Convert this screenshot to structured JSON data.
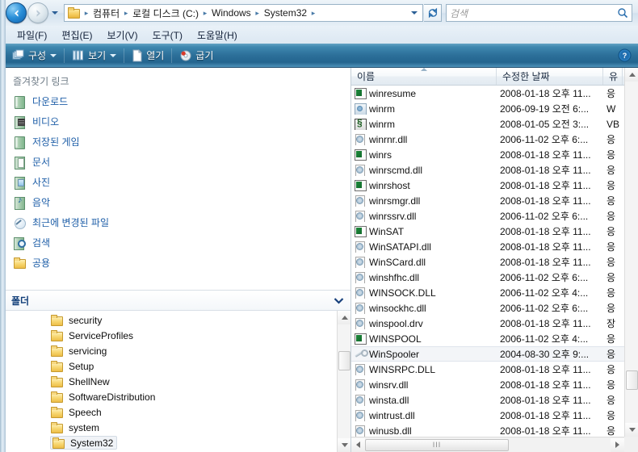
{
  "window": {
    "nav": {
      "back_label": "뒤로",
      "forward_label": "앞으로",
      "history_label": "최근 위치",
      "refresh_label": "새로 고침"
    },
    "breadcrumb": {
      "items": [
        "컴퓨터",
        "로컬 디스크 (C:)",
        "Windows",
        "System32"
      ],
      "separator": "▸"
    },
    "search": {
      "placeholder": "검색"
    }
  },
  "menubar": {
    "items": [
      "파일(F)",
      "편집(E)",
      "보기(V)",
      "도구(T)",
      "도움말(H)"
    ]
  },
  "toolbar": {
    "organize": "구성",
    "views": "보기",
    "open": "열기",
    "burn": "굽기",
    "help_label": "도움말"
  },
  "sidebar": {
    "favorites_title": "즐겨찾기 링크",
    "items": [
      {
        "label": "다운로드",
        "icon": "shellfolder-icon"
      },
      {
        "label": "비디오",
        "icon": "video-folder-icon"
      },
      {
        "label": "저장된 게임",
        "icon": "shellfolder-icon"
      },
      {
        "label": "문서",
        "icon": "documents-folder-icon"
      },
      {
        "label": "사진",
        "icon": "pictures-folder-icon"
      },
      {
        "label": "음악",
        "icon": "music-folder-icon"
      },
      {
        "label": "최근에 변경된 파일",
        "icon": "recent-changes-icon"
      },
      {
        "label": "검색",
        "icon": "saved-search-icon"
      },
      {
        "label": "공용",
        "icon": "public-folder-icon"
      }
    ],
    "folders_title": "폴더",
    "tree": [
      {
        "label": "security",
        "selected": false
      },
      {
        "label": "ServiceProfiles",
        "selected": false
      },
      {
        "label": "servicing",
        "selected": false
      },
      {
        "label": "Setup",
        "selected": false
      },
      {
        "label": "ShellNew",
        "selected": false
      },
      {
        "label": "SoftwareDistribution",
        "selected": false
      },
      {
        "label": "Speech",
        "selected": false
      },
      {
        "label": "system",
        "selected": false
      },
      {
        "label": "System32",
        "selected": true
      }
    ]
  },
  "filelist": {
    "columns": [
      {
        "label": "이름",
        "sorted": "asc"
      },
      {
        "label": "수정한 날짜",
        "sorted": ""
      },
      {
        "label": "유",
        "sorted": ""
      }
    ],
    "rows": [
      {
        "name": "winresume",
        "date": "2008-01-18 오후 11...",
        "type": "응",
        "icon": "exe",
        "selected": false
      },
      {
        "name": "winrm",
        "date": "2006-09-19 오전 6:...",
        "type": "W",
        "icon": "cmd",
        "selected": false
      },
      {
        "name": "winrm",
        "date": "2008-01-05 오전 3:...",
        "type": "VB",
        "icon": "vbs",
        "selected": false
      },
      {
        "name": "winrnr.dll",
        "date": "2006-11-02 오후 6:...",
        "type": "응",
        "icon": "dll",
        "selected": false
      },
      {
        "name": "winrs",
        "date": "2008-01-18 오후 11...",
        "type": "응",
        "icon": "exe",
        "selected": false
      },
      {
        "name": "winrscmd.dll",
        "date": "2008-01-18 오후 11...",
        "type": "응",
        "icon": "dll",
        "selected": false
      },
      {
        "name": "winrshost",
        "date": "2008-01-18 오후 11...",
        "type": "응",
        "icon": "exe",
        "selected": false
      },
      {
        "name": "winrsmgr.dll",
        "date": "2008-01-18 오후 11...",
        "type": "응",
        "icon": "dll",
        "selected": false
      },
      {
        "name": "winrssrv.dll",
        "date": "2006-11-02 오후 6:...",
        "type": "응",
        "icon": "dll",
        "selected": false
      },
      {
        "name": "WinSAT",
        "date": "2008-01-18 오후 11...",
        "type": "응",
        "icon": "exe",
        "selected": false
      },
      {
        "name": "WinSATAPI.dll",
        "date": "2008-01-18 오후 11...",
        "type": "응",
        "icon": "dll",
        "selected": false
      },
      {
        "name": "WinSCard.dll",
        "date": "2008-01-18 오후 11...",
        "type": "응",
        "icon": "dll",
        "selected": false
      },
      {
        "name": "winshfhc.dll",
        "date": "2006-11-02 오후 6:...",
        "type": "응",
        "icon": "dll",
        "selected": false
      },
      {
        "name": "WINSOCK.DLL",
        "date": "2006-11-02 오후 4:...",
        "type": "응",
        "icon": "dll",
        "selected": false
      },
      {
        "name": "winsockhc.dll",
        "date": "2006-11-02 오후 6:...",
        "type": "응",
        "icon": "dll",
        "selected": false
      },
      {
        "name": "winspool.drv",
        "date": "2008-01-18 오후 11...",
        "type": "장",
        "icon": "drv",
        "selected": false
      },
      {
        "name": "WINSPOOL",
        "date": "2006-11-02 오후 4:...",
        "type": "응",
        "icon": "exe",
        "selected": false
      },
      {
        "name": "WinSpooler",
        "date": "2004-08-30 오후 9:...",
        "type": "응",
        "icon": "wrench",
        "selected": true
      },
      {
        "name": "WINSRPC.DLL",
        "date": "2008-01-18 오후 11...",
        "type": "응",
        "icon": "dll",
        "selected": false
      },
      {
        "name": "winsrv.dll",
        "date": "2008-01-18 오후 11...",
        "type": "응",
        "icon": "dll",
        "selected": false
      },
      {
        "name": "winsta.dll",
        "date": "2008-01-18 오후 11...",
        "type": "응",
        "icon": "dll",
        "selected": false
      },
      {
        "name": "wintrust.dll",
        "date": "2008-01-18 오후 11...",
        "type": "응",
        "icon": "dll",
        "selected": false
      },
      {
        "name": "winusb.dll",
        "date": "2008-01-18 오후 11...",
        "type": "응",
        "icon": "dll",
        "selected": false
      }
    ]
  },
  "colors": {
    "toolbar_blue": "#2c6f99",
    "link_blue": "#1f5fa8",
    "selection": "#f3f5f8"
  }
}
